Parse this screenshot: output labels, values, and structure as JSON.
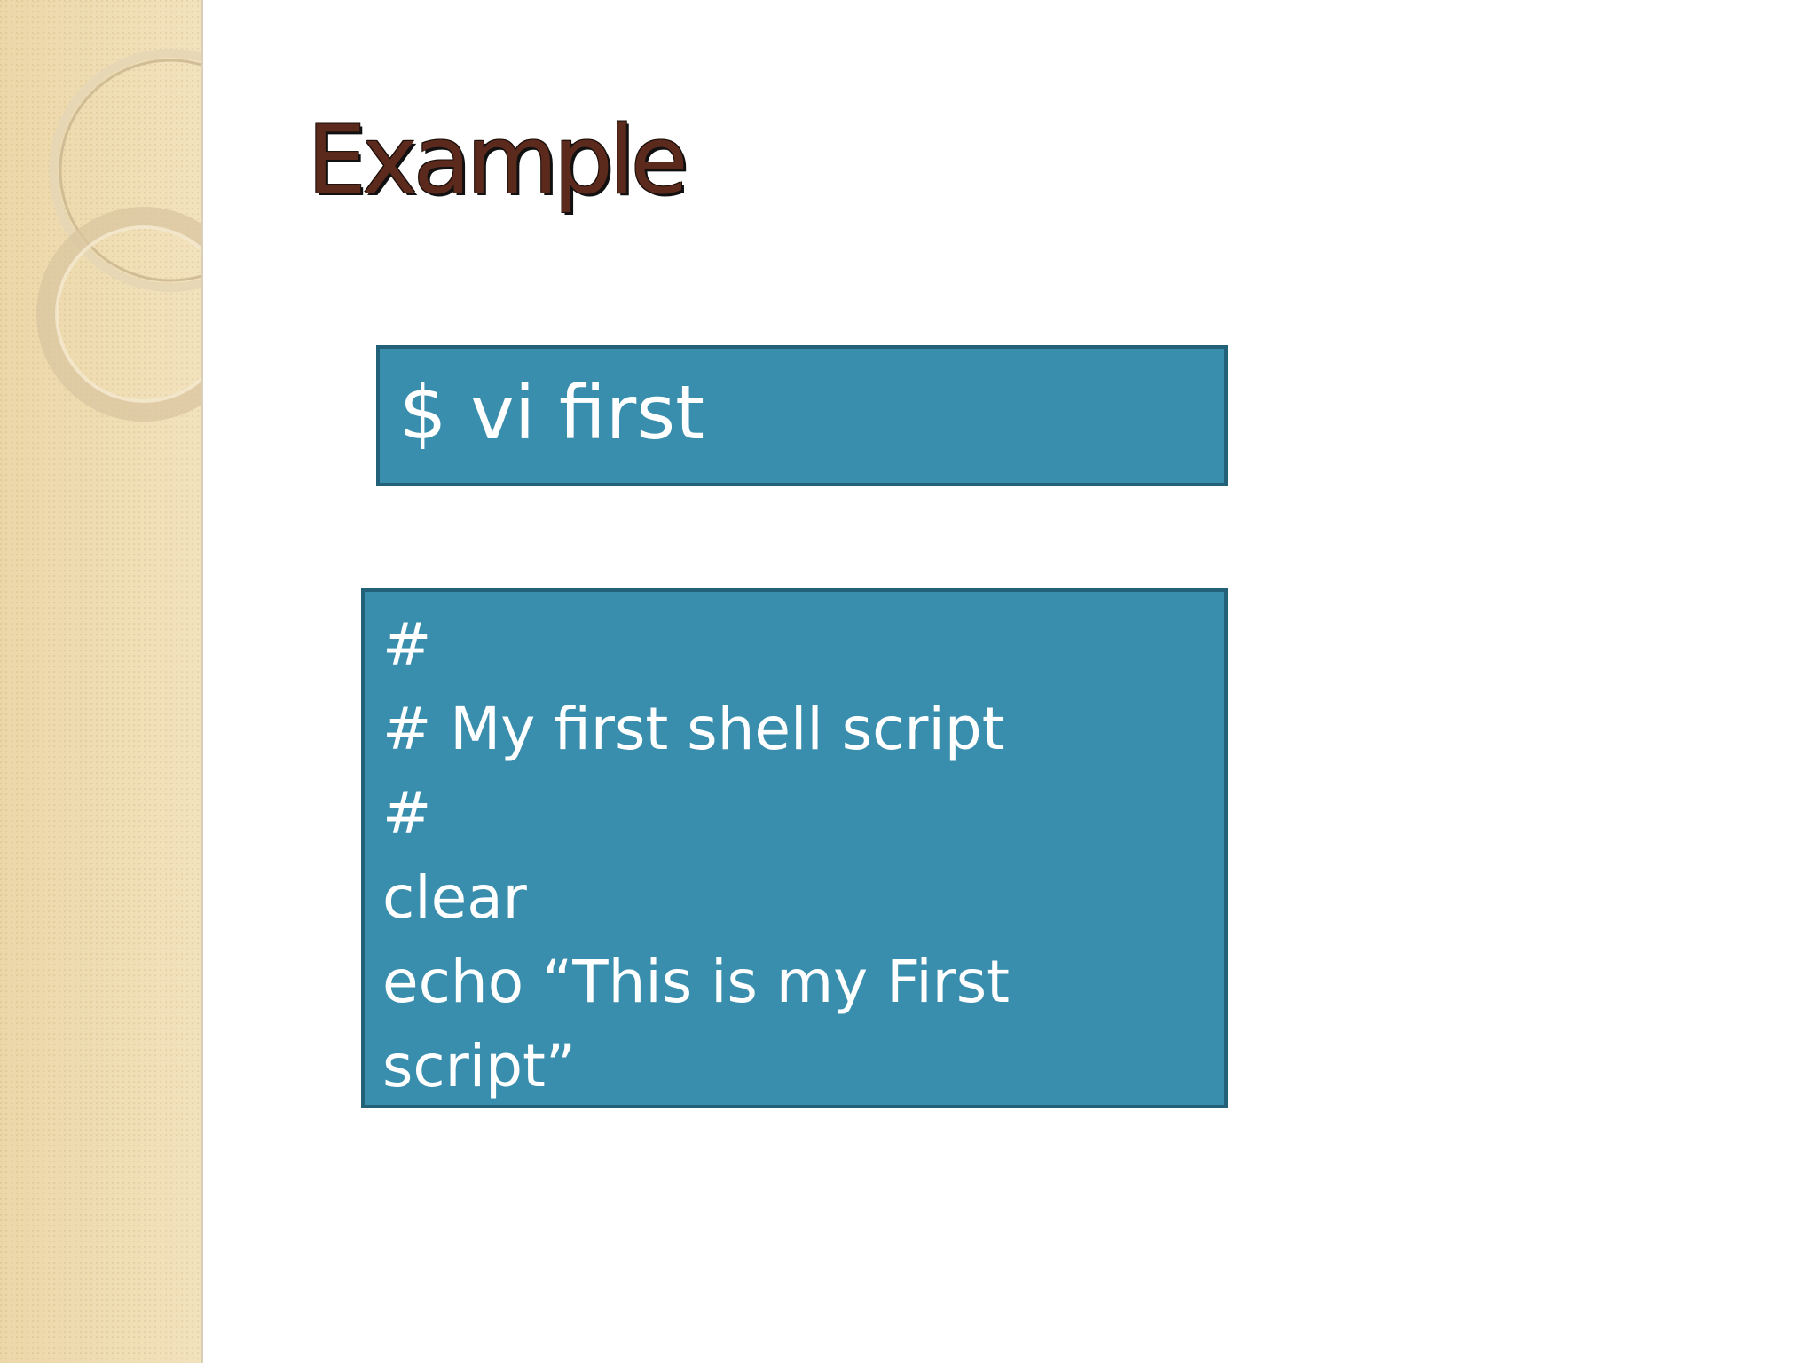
{
  "slide": {
    "title": "Example",
    "command_box": {
      "text": "$ vi first"
    },
    "script_box": {
      "lines": [
        "#",
        "# My first shell script",
        "#",
        "clear",
        "echo “This is my First",
        "script”"
      ]
    }
  },
  "colors": {
    "title_text": "#5c2a1c",
    "box_fill": "#3a8ead",
    "box_border": "#236178",
    "box_text": "#ffffff",
    "side_panel": "#efdcb0"
  }
}
